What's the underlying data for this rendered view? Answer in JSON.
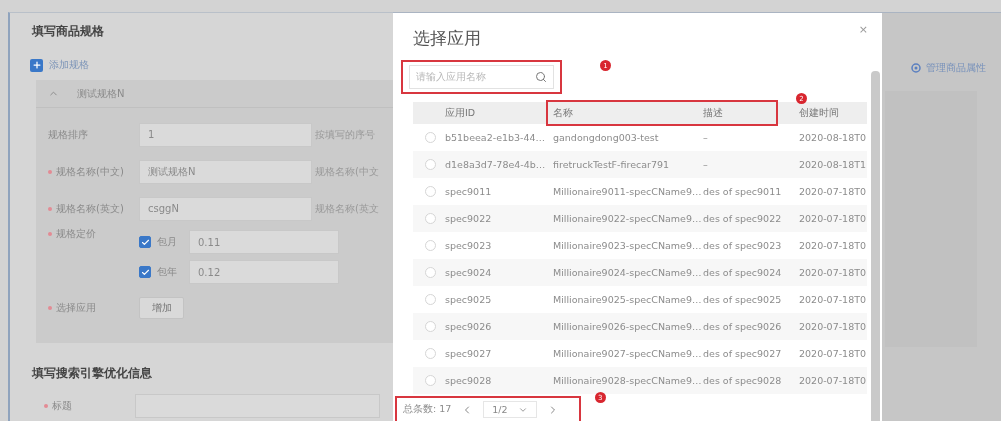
{
  "form": {
    "title": "填写商品规格",
    "add_link": "添加规格",
    "spec": {
      "name": "测试规格N",
      "expanded": true,
      "fields": [
        {
          "kind": "input",
          "label": "规格排序",
          "required": false,
          "value": "1",
          "hint": "按填写的序号"
        },
        {
          "kind": "input",
          "label": "规格名称(中文)",
          "required": true,
          "value": "测试规格N",
          "hint": "规格名称(中文"
        },
        {
          "kind": "input",
          "label": "规格名称(英文)",
          "required": true,
          "value": "csggN",
          "hint": "规格名称(英文"
        },
        {
          "kind": "prices",
          "label": "规格定价",
          "required": true,
          "options": [
            {
              "label": "包月",
              "checked": true,
              "value": "0.11"
            },
            {
              "label": "包年",
              "checked": true,
              "value": "0.12"
            }
          ]
        },
        {
          "kind": "button",
          "label": "选择应用",
          "required": true,
          "button": "增加"
        }
      ]
    },
    "seo": {
      "title": "填写搜索引擎优化信息",
      "fields": [
        {
          "label": "标题",
          "required": true
        }
      ]
    }
  },
  "side_link": "管理商品属性",
  "dialog": {
    "title": "选择应用",
    "close": "×",
    "search": {
      "placeholder": "请输入应用名称"
    },
    "columns": [
      "应用ID",
      "名称",
      "描述",
      "创建时间"
    ],
    "rows": [
      {
        "selected": false,
        "cells": [
          "b51beea2-e1b3-44…",
          "gandongdong003-test",
          "–",
          "2020-08-18T0"
        ]
      },
      {
        "selected": false,
        "cells": [
          "d1e8a3d7-78e4-4b…",
          "firetruckTestF-firecar791",
          "–",
          "2020-08-18T1"
        ]
      },
      {
        "selected": false,
        "cells": [
          "spec9011",
          "Millionaire9011-specCName9…",
          "des of spec9011",
          "2020-07-18T0"
        ]
      },
      {
        "selected": false,
        "cells": [
          "spec9022",
          "Millionaire9022-specCName9…",
          "des of spec9022",
          "2020-07-18T0"
        ]
      },
      {
        "selected": false,
        "cells": [
          "spec9023",
          "Millionaire9023-specCName9…",
          "des of spec9023",
          "2020-07-18T0"
        ]
      },
      {
        "selected": false,
        "cells": [
          "spec9024",
          "Millionaire9024-specCName9…",
          "des of spec9024",
          "2020-07-18T0"
        ]
      },
      {
        "selected": false,
        "cells": [
          "spec9025",
          "Millionaire9025-specCName9…",
          "des of spec9025",
          "2020-07-18T0"
        ]
      },
      {
        "selected": false,
        "cells": [
          "spec9026",
          "Millionaire9026-specCName9…",
          "des of spec9026",
          "2020-07-18T0"
        ]
      },
      {
        "selected": false,
        "cells": [
          "spec9027",
          "Millionaire9027-specCName9…",
          "des of spec9027",
          "2020-07-18T0"
        ]
      },
      {
        "selected": false,
        "cells": [
          "spec9028",
          "Millionaire9028-specCName9…",
          "des of spec9028",
          "2020-07-18T0"
        ]
      }
    ],
    "pagination": {
      "total": "总条数: 17",
      "page": "1/2"
    },
    "callouts": [
      "1",
      "2",
      "3"
    ]
  }
}
